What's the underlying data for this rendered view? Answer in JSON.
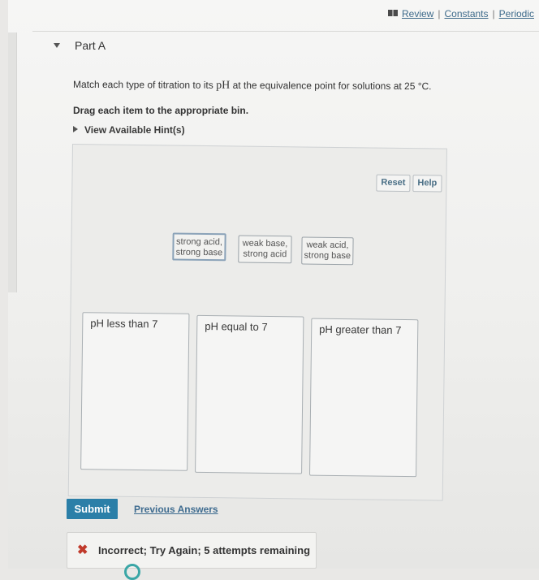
{
  "top_links": {
    "review": "Review",
    "constants": "Constants",
    "periodic": "Periodic",
    "separator": "|"
  },
  "part": {
    "label": "Part A"
  },
  "question": {
    "text_before": "Match each type of titration to its",
    "ph_symbol": "pH",
    "text_after": "at the equivalence point for solutions at 25 °C.",
    "instruction": "Drag each item to the appropriate bin.",
    "hints_label": "View Available Hint(s)"
  },
  "workspace": {
    "reset_label": "Reset",
    "help_label": "Help",
    "tokens": [
      {
        "line1": "strong acid,",
        "line2": "strong base"
      },
      {
        "line1": "weak base,",
        "line2": "strong acid"
      },
      {
        "line1": "weak acid,",
        "line2": "strong base"
      }
    ],
    "bins": [
      {
        "label": "pH less than 7"
      },
      {
        "label": "pH equal to 7"
      },
      {
        "label": "pH greater than 7"
      }
    ]
  },
  "actions": {
    "submit_label": "Submit",
    "previous_answers_label": "Previous Answers"
  },
  "feedback": {
    "icon": "x-icon",
    "message": "Incorrect; Try Again; 5 attempts remaining",
    "status_color": "#c03a2b"
  },
  "colors": {
    "accent": "#2b7fa8",
    "link": "#3d6a8a"
  }
}
